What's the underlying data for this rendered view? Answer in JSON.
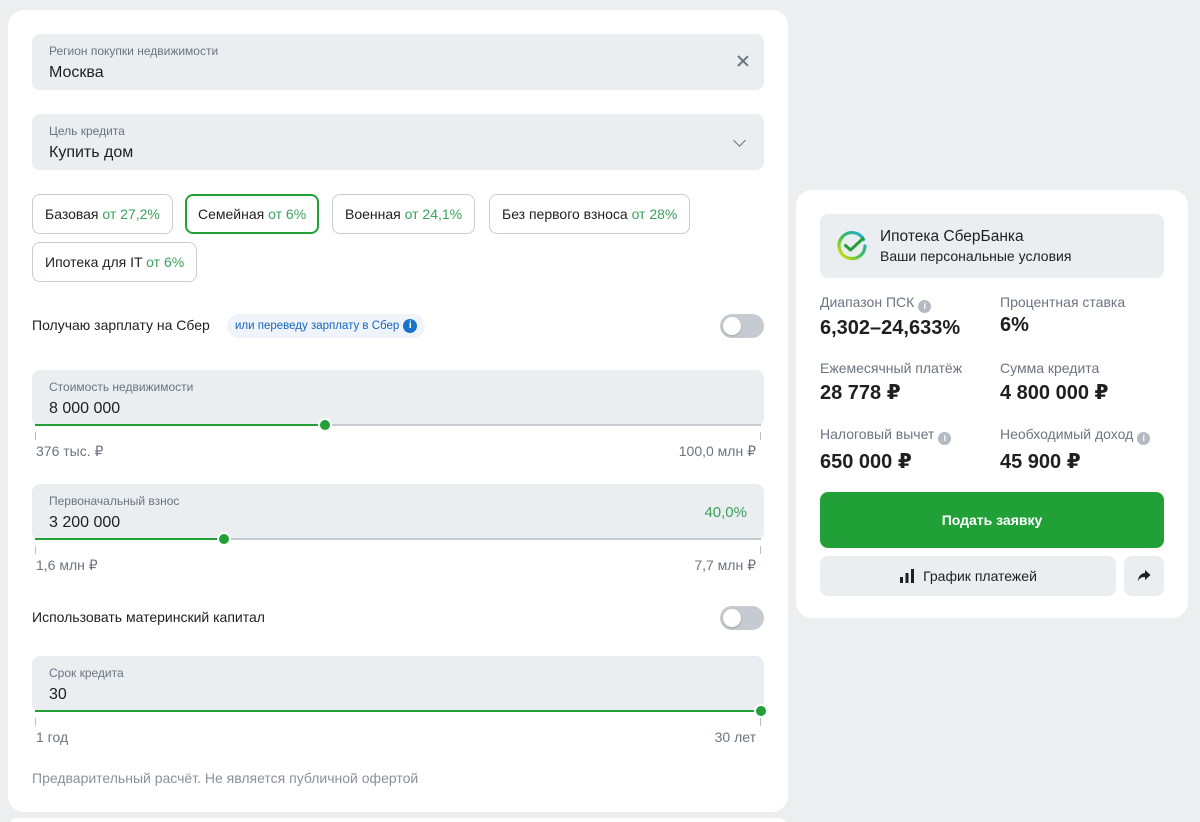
{
  "form": {
    "region": {
      "label": "Регион покупки недвижимости",
      "value": "Москва"
    },
    "goal": {
      "label": "Цель кредита",
      "value": "Купить дом"
    },
    "programs": [
      {
        "name": "Базовая",
        "rate": "от 27,2%",
        "selected": false
      },
      {
        "name": "Семейная",
        "rate": "от 6%",
        "selected": true
      },
      {
        "name": "Военная",
        "rate": "от 24,1%",
        "selected": false
      },
      {
        "name": "Без первого взноса",
        "rate": "от 28%",
        "selected": false
      },
      {
        "name": "Ипотека для IT",
        "rate": "от 6%",
        "selected": false
      }
    ],
    "salary": {
      "label": "Получаю зарплату на Сбер",
      "hint": "или переведу зарплату в Сбер",
      "on": false
    },
    "property_cost": {
      "label": "Стоимость недвижимости",
      "value": "8 000 000",
      "min_label": "376 тыс. ₽",
      "max_label": "100,0 млн ₽",
      "level": 0.4
    },
    "down_payment": {
      "label": "Первоначальный взнос",
      "value": "3 200 000",
      "percent": "40,0%",
      "min_label": "1,6 млн ₽",
      "max_label": "7,7 млн ₽",
      "level": 0.26
    },
    "maternity": {
      "label": "Использовать материнский капитал",
      "on": false
    },
    "term": {
      "label": "Срок кредита",
      "value": "30",
      "min_label": "1 год",
      "max_label": "30 лет",
      "level": 1.0
    },
    "disclaimer": "Предварительный расчёт. Не является публичной офертой"
  },
  "offer": {
    "title": "Ипотека СберБанка",
    "subtitle": "Ваши персональные условия",
    "metrics": {
      "psk": {
        "label": "Диапазон ПСК",
        "value": "6,302–24,633%"
      },
      "rate": {
        "label": "Процентная ставка",
        "value": "6%"
      },
      "monthly": {
        "label": "Ежемесячный платёж",
        "value": "28 778 ₽"
      },
      "amount": {
        "label": "Сумма кредита",
        "value": "4 800 000 ₽"
      },
      "tax": {
        "label": "Налоговый вычет",
        "value": "650 000 ₽"
      },
      "income": {
        "label": "Необходимый доход",
        "value": "45 900 ₽"
      }
    },
    "apply_label": "Подать заявку",
    "schedule_label": "График платежей"
  },
  "colors": {
    "accent": "#21a038",
    "accent_text": "#3aa25c",
    "field_bg": "#eaeef1",
    "info_blue": "#1a73c8"
  }
}
